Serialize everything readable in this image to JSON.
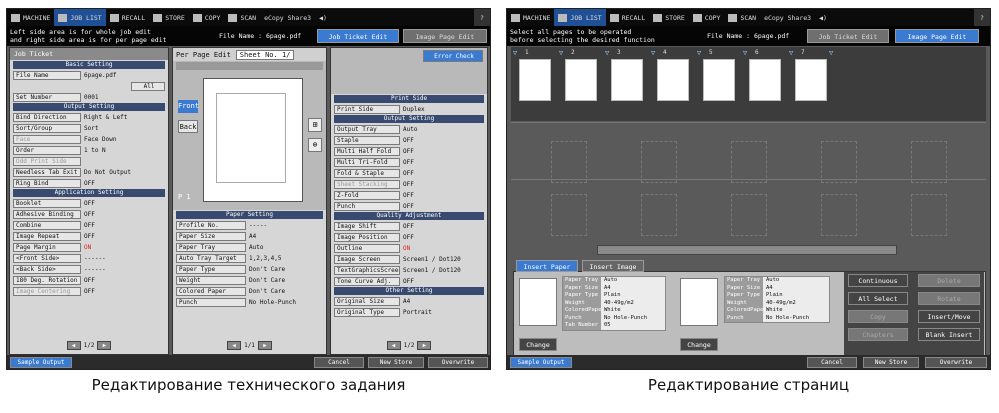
{
  "topbar": [
    "MACHINE",
    "JOB LIST",
    "RECALL",
    "STORE",
    "COPY",
    "SCAN",
    "eCopy Share3",
    "◀)",
    "?"
  ],
  "left": {
    "message": [
      "Left side area is for whole job edit",
      "and right side area is for per page edit"
    ],
    "file_name_label": "File Name",
    "file_name": "6page.pdf",
    "tab_job": "Job Ticket Edit",
    "tab_image": "Image Page Edit",
    "job_ticket_title": "Job Ticket",
    "basic_setting": "Basic Setting",
    "file_name_btn": "File Name",
    "file_name_val": "6page.pdf",
    "all_btn": "All",
    "set_number_btn": "Set Number",
    "set_number_val": "0001",
    "output_setting": "Output Setting",
    "output_rows": [
      [
        "Bind Direction",
        "Right & Left"
      ],
      [
        "Sort/Group",
        "Sort"
      ],
      [
        "Face",
        "Face Down"
      ],
      [
        "Order",
        "1 to N"
      ],
      [
        "Odd Print Side",
        ""
      ],
      [
        "Needless Tab Exit",
        "Do Not Output"
      ],
      [
        "Ring Bind",
        "OFF"
      ]
    ],
    "app_setting": "Application Setting",
    "app_rows": [
      [
        "Booklet",
        "OFF"
      ],
      [
        "Adhesive Binding",
        "OFF"
      ],
      [
        "Combine",
        "OFF"
      ],
      [
        "Image Repeat",
        "OFF"
      ],
      [
        "Page Margin",
        "ON"
      ],
      [
        "<Front Side>",
        "------"
      ],
      [
        "<Back Side>",
        "------"
      ],
      [
        "180 Deg. Rotation",
        "OFF"
      ],
      [
        "Image Centering",
        "OFF"
      ]
    ],
    "left_pager": "1/2",
    "per_page_edit": "Per Page Edit",
    "sheet_no": "Sheet No.",
    "sheet_val": "1/",
    "error_check": "Error Check",
    "front_btn": "Front",
    "back_btn": "Back",
    "preview_pages": "P 1",
    "paper_setting": "Paper Setting",
    "paper_rows": [
      [
        "Profile No.",
        "-----"
      ],
      [
        "Paper Size",
        "A4"
      ],
      [
        "Paper Tray",
        "Auto"
      ],
      [
        "Auto Tray Target",
        "1,2,3,4,5"
      ],
      [
        "Paper Type",
        "Don't Care"
      ],
      [
        "Weight",
        "Don't Care"
      ],
      [
        "Colored Paper",
        "Don't Care"
      ],
      [
        "Punch",
        "No Hole-Punch"
      ]
    ],
    "mid_pager": "1/1",
    "print_side": "Print Side",
    "print_side_row": [
      "Print Side",
      "Duplex"
    ],
    "r_output_setting": "Output Setting",
    "r_output_rows": [
      [
        "Output Tray",
        "Auto"
      ],
      [
        "Staple",
        "OFF"
      ],
      [
        "Multi Half Fold",
        "OFF"
      ],
      [
        "Multi Tri-Fold",
        "OFF"
      ],
      [
        "Fold & Staple",
        "OFF"
      ],
      [
        "Sheet Stacking",
        "OFF"
      ],
      [
        "Z-Fold",
        "OFF"
      ],
      [
        "Punch",
        "OFF"
      ]
    ],
    "quality": "Quality Adjustment",
    "quality_rows": [
      [
        "Image Shift",
        "OFF"
      ],
      [
        "Image Position",
        "OFF"
      ],
      [
        "Outline",
        "ON"
      ],
      [
        "Image Screen",
        "Screen1 / Dot120"
      ],
      [
        "TextGraphicsScreen",
        "Screen1 / Dot120"
      ],
      [
        "Tone Curve Adj.",
        "OFF"
      ]
    ],
    "other_setting": "Other Setting",
    "other_rows": [
      [
        "Original Size",
        "A4"
      ],
      [
        "Original Type",
        "Portrait"
      ]
    ],
    "right_pager": "1/2",
    "sample_output": "Sample Output",
    "cancel": "Cancel",
    "new_store": "New Store",
    "overwrite": "Overwrite"
  },
  "right": {
    "message": [
      "Select all pages to be operated",
      "before selecting the desired function"
    ],
    "file_name_label": "File Name",
    "file_name": "6page.pdf",
    "tab_job": "Job Ticket Edit",
    "tab_image": "Image Page Edit",
    "page_labels": [
      "1",
      "2",
      "3",
      "4",
      "5",
      "6",
      "7"
    ],
    "tab_insert_paper": "Insert Paper",
    "tab_insert_image": "Insert Image",
    "t1": [
      [
        "Paper Tray",
        "Auto"
      ],
      [
        "Paper Size",
        "A4"
      ],
      [
        "Paper Type",
        "Plain"
      ],
      [
        "Weight",
        "40-49g/m2"
      ],
      [
        "ColoredPaper",
        "White"
      ],
      [
        "Punch",
        "No Hole-Punch"
      ],
      [
        "Tab Number",
        "05"
      ]
    ],
    "t2": [
      [
        "Paper Tray",
        "Auto"
      ],
      [
        "Paper Size",
        "A4"
      ],
      [
        "Paper Type",
        "Plain"
      ],
      [
        "Weight",
        "40-49g/m2"
      ],
      [
        "ColoredPaper",
        "White"
      ],
      [
        "Punch",
        "No Hole-Punch"
      ]
    ],
    "change1": "Change",
    "change2": "Change",
    "btns": [
      "Continuous",
      "Delete",
      "All Select",
      "Rotate",
      "Copy",
      "Insert/Move",
      "Chapters",
      "Blank Insert"
    ],
    "sample_output": "Sample Output",
    "cancel": "Cancel",
    "new_store": "New Store",
    "overwrite": "Overwrite"
  },
  "captions": [
    "Редактирование технического задания",
    "Редактирование страниц"
  ]
}
